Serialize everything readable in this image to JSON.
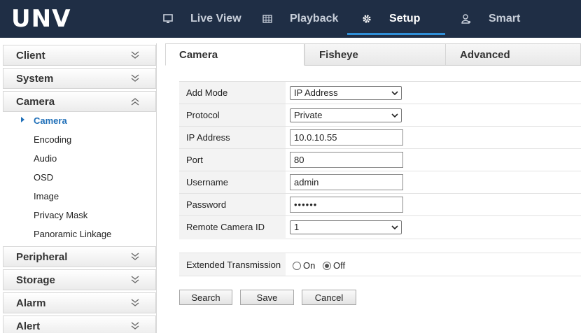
{
  "app": {
    "logo_text": "UNV"
  },
  "nav": {
    "items": [
      {
        "label": "Live View",
        "icon": "monitor-icon"
      },
      {
        "label": "Playback",
        "icon": "film-icon"
      },
      {
        "label": "Setup",
        "icon": "gear-icon",
        "active": true
      },
      {
        "label": "Smart",
        "icon": "person-icon"
      }
    ],
    "accent_color": "#2f8fd8",
    "bar_color": "#1f2e45"
  },
  "sidebar": {
    "sections": [
      {
        "label": "Client",
        "expanded": false
      },
      {
        "label": "System",
        "expanded": false
      },
      {
        "label": "Camera",
        "expanded": true
      },
      {
        "label": "Peripheral",
        "expanded": false
      },
      {
        "label": "Storage",
        "expanded": false
      },
      {
        "label": "Alarm",
        "expanded": false
      },
      {
        "label": "Alert",
        "expanded": false
      }
    ],
    "camera_items": [
      "Camera",
      "Encoding",
      "Audio",
      "OSD",
      "Image",
      "Privacy Mask",
      "Panoramic Linkage"
    ],
    "active_item": "Camera"
  },
  "tabs": [
    {
      "label": "Camera",
      "active": true
    },
    {
      "label": "Fisheye",
      "active": false
    },
    {
      "label": "Advanced",
      "active": false
    }
  ],
  "form": {
    "add_mode": {
      "label": "Add Mode",
      "value": "IP Address"
    },
    "protocol": {
      "label": "Protocol",
      "value": "Private"
    },
    "ip_address": {
      "label": "IP Address",
      "value": "10.0.10.55"
    },
    "port": {
      "label": "Port",
      "value": "80"
    },
    "username": {
      "label": "Username",
      "value": "admin"
    },
    "password": {
      "label": "Password",
      "value": "••••••"
    },
    "remote_camera_id": {
      "label": "Remote Camera ID",
      "value": "1"
    },
    "extended_transmission": {
      "label": "Extended Transmission",
      "on_label": "On",
      "off_label": "Off",
      "selected": "Off"
    }
  },
  "buttons": {
    "search": "Search",
    "save": "Save",
    "cancel": "Cancel"
  }
}
